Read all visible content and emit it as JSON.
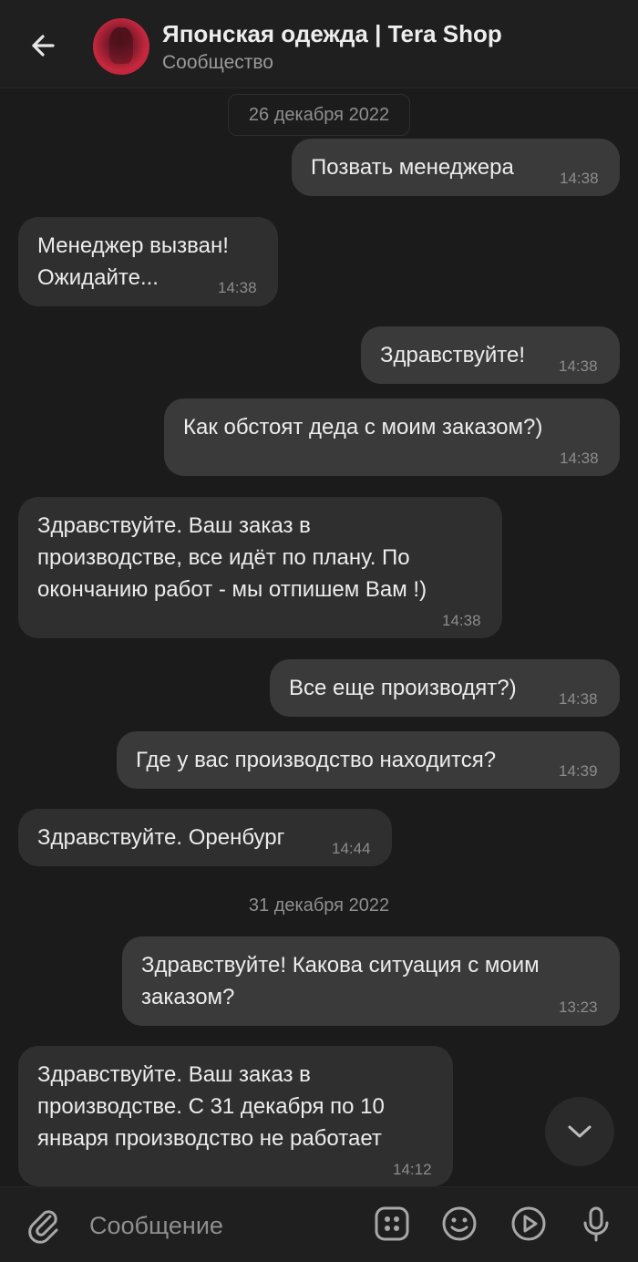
{
  "header": {
    "title": "Японская одежда | Tera Shop",
    "subtitle": "Сообщество"
  },
  "dates": {
    "first": "26 декабря 2022",
    "second": "31 декабря 2022"
  },
  "messages": [
    {
      "dir": "out",
      "lines": [
        "Позвать менеджера"
      ],
      "time": "14:38"
    },
    {
      "dir": "in",
      "lines": [
        "Менеджер вызван!",
        "Ожидайте..."
      ],
      "time": "14:38"
    },
    {
      "dir": "out",
      "lines": [
        "Здравствуйте!"
      ],
      "time": "14:38"
    },
    {
      "dir": "out",
      "lines": [
        "Как обстоят деда с моим заказом?)"
      ],
      "time": "14:38"
    },
    {
      "dir": "in",
      "lines": [
        "Здравствуйте. Ваш заказ в",
        "производстве, все идёт по плану. По",
        "окончанию работ - мы отпишем Вам !)"
      ],
      "time": "14:38"
    },
    {
      "dir": "out",
      "lines": [
        "Все еще производят?)"
      ],
      "time": "14:38"
    },
    {
      "dir": "out",
      "lines": [
        "Где у вас производство находится?"
      ],
      "time": "14:39"
    },
    {
      "dir": "in",
      "lines": [
        "Здравствуйте. Оренбург"
      ],
      "time": "14:44"
    },
    {
      "dir": "out",
      "lines": [
        "Здравствуйте! Какова ситуация с моим",
        "заказом?"
      ],
      "time": "13:23"
    },
    {
      "dir": "in",
      "lines": [
        "Здравствуйте. Ваш заказ в",
        "производстве. С 31 декабря по 10",
        "января производство не работает"
      ],
      "time": "14:12"
    }
  ],
  "composer": {
    "placeholder": "Сообщение"
  },
  "icons": {
    "back": "arrow-left-icon",
    "scroll_down": "chevron-down-icon",
    "attach": "paperclip-icon",
    "apps": "apps-grid-icon",
    "emoji": "smile-icon",
    "video": "play-circle-icon",
    "voice": "microphone-icon"
  },
  "colors": {
    "background": "#1b1b1b",
    "outgoing_bubble": "#3a3a3a",
    "incoming_bubble": "#2f2f2f"
  }
}
